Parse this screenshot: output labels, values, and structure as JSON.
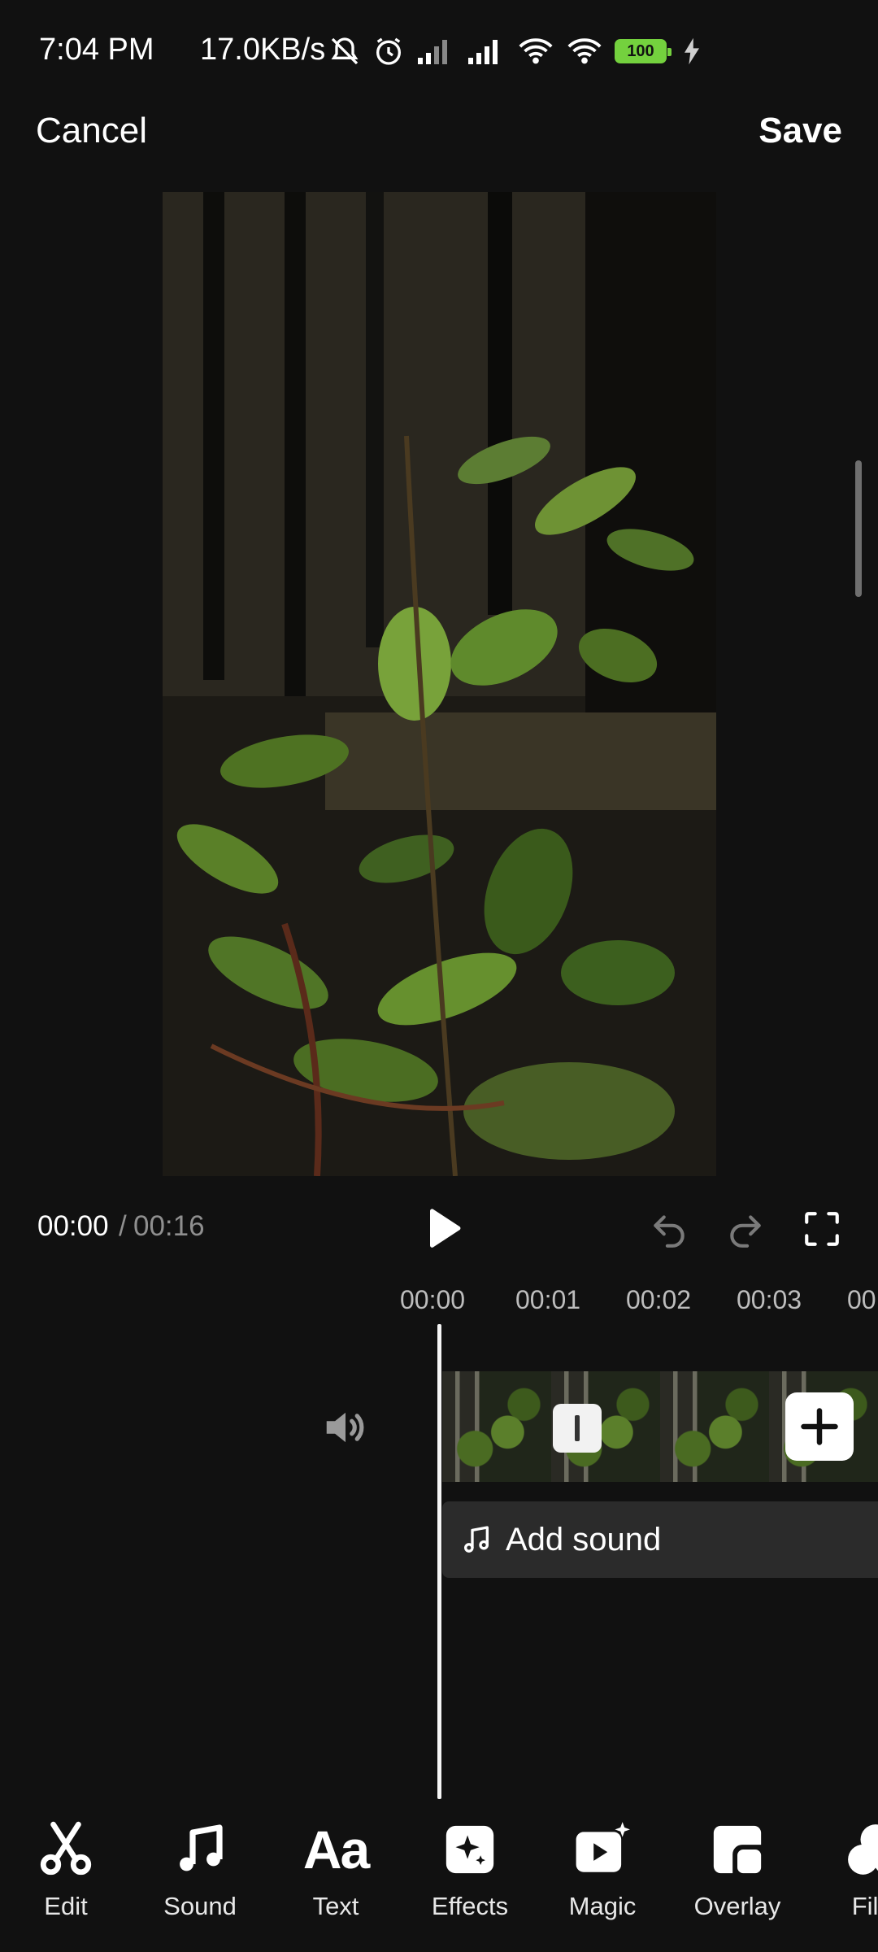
{
  "status_bar": {
    "time": "7:04 PM",
    "net_speed": "17.0KB/s",
    "battery": "100",
    "icons": [
      "mute-bell-icon",
      "alarm-icon",
      "signal-icon",
      "signal-icon",
      "wifi-icon",
      "wifi-icon",
      "battery-icon",
      "charging-icon"
    ]
  },
  "top_bar": {
    "cancel_label": "Cancel",
    "save_label": "Save"
  },
  "playback": {
    "current_time": "00:00",
    "separator": "/",
    "total_time": "00:16"
  },
  "timeline": {
    "ticks": [
      "00:00",
      "00:01",
      "00:02",
      "00:03",
      "00"
    ],
    "add_sound_label": "Add sound"
  },
  "toolbar": {
    "items": [
      {
        "label": "Edit",
        "icon": "scissors-icon"
      },
      {
        "label": "Sound",
        "icon": "music-note-icon"
      },
      {
        "label": "Text",
        "icon": "text-aa-icon"
      },
      {
        "label": "Effects",
        "icon": "sparkle-icon"
      },
      {
        "label": "Magic",
        "icon": "magic-play-icon"
      },
      {
        "label": "Overlay",
        "icon": "overlay-icon"
      },
      {
        "label": "Filte",
        "icon": "filter-icon"
      }
    ]
  },
  "colors": {
    "background": "#111111",
    "accent_battery": "#74d13e",
    "muted_text": "#8f8f8f"
  }
}
